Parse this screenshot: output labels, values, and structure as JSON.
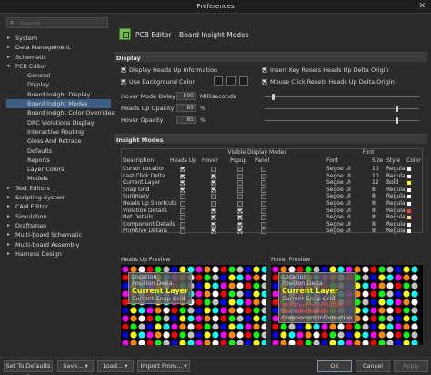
{
  "window": {
    "title": "Preferences",
    "close_glyph": "✕"
  },
  "search": {
    "placeholder": "Search"
  },
  "tree": [
    {
      "label": "System",
      "child": false,
      "arrow": "▸"
    },
    {
      "label": "Data Management",
      "child": false,
      "arrow": "▸"
    },
    {
      "label": "Schematic",
      "child": false,
      "arrow": "▸"
    },
    {
      "label": "PCB Editor",
      "child": false,
      "arrow": "▾"
    },
    {
      "label": "General",
      "child": true
    },
    {
      "label": "Display",
      "child": true
    },
    {
      "label": "Board Insight Display",
      "child": true
    },
    {
      "label": "Board Insight Modes",
      "child": true,
      "selected": true
    },
    {
      "label": "Board Insight Color Overrides",
      "child": true
    },
    {
      "label": "DRC Violations Display",
      "child": true
    },
    {
      "label": "Interactive Routing",
      "child": true
    },
    {
      "label": "Gloss And Retrace",
      "child": true
    },
    {
      "label": "Defaults",
      "child": true
    },
    {
      "label": "Reports",
      "child": true
    },
    {
      "label": "Layer Colors",
      "child": true
    },
    {
      "label": "Models",
      "child": true
    },
    {
      "label": "Text Editors",
      "child": false,
      "arrow": "▸"
    },
    {
      "label": "Scripting System",
      "child": false,
      "arrow": "▸"
    },
    {
      "label": "CAM Editor",
      "child": false,
      "arrow": "▸"
    },
    {
      "label": "Simulation",
      "child": false,
      "arrow": "▸"
    },
    {
      "label": "Draftsman",
      "child": false,
      "arrow": "▸"
    },
    {
      "label": "Multi-board Schematic",
      "child": false,
      "arrow": "▸"
    },
    {
      "label": "Multi-board Assembly",
      "child": false,
      "arrow": "▸"
    },
    {
      "label": "Harness Design",
      "child": false,
      "arrow": "▸"
    }
  ],
  "header": {
    "title": "PCB Editor – Board Insight Modes"
  },
  "display": {
    "section_title": "Display",
    "display_heads_up": "Display Heads Up Information",
    "use_background_color": "Use Background Color",
    "insert_key_resets": "Insert Key Resets Heads Up Delta Origin",
    "mouse_click_resets": "Mouse Click Resets Heads Up Delta Origin",
    "hover_mode_delay_label": "Hover Mode Delay",
    "hover_mode_delay_value": "500",
    "hover_mode_delay_unit": "Milliseconds",
    "heads_up_opacity_label": "Heads Up Opacity",
    "heads_up_opacity_value": "85",
    "hover_opacity_label": "Hover Opacity",
    "hover_opacity_value": "85",
    "percent": "%",
    "heads_up_opacity_level": 0.85,
    "hover_opacity_level": 0.85,
    "hover_delay_level": 0.05
  },
  "modes": {
    "section_title": "Insight Modes",
    "group_visible": "Visible Display Modes",
    "group_font": "Font",
    "columns": [
      "Description",
      "Heads Up",
      "Hover",
      "Popup",
      "Panel",
      "Font",
      "Size",
      "Style",
      "Color"
    ],
    "rows": [
      {
        "desc": "Cursor Location",
        "heads": true,
        "hover": false,
        "popup": false,
        "panel": false,
        "font": "Segoe UI",
        "size": "10",
        "style": "Regular",
        "color": "#ffffff"
      },
      {
        "desc": "Last Click Delta",
        "heads": true,
        "hover": true,
        "popup": false,
        "panel": false,
        "font": "Segoe UI",
        "size": "10",
        "style": "Regular",
        "color": "#ffffff"
      },
      {
        "desc": "Current Layer",
        "heads": true,
        "hover": true,
        "popup": false,
        "panel": false,
        "font": "Segoe UI",
        "size": "12",
        "style": "Bold",
        "color": "#ffff00"
      },
      {
        "desc": "Snap Grid",
        "heads": true,
        "hover": true,
        "popup": false,
        "panel": false,
        "font": "Segoe UI",
        "size": "8",
        "style": "Regular",
        "color": "#ffffff"
      },
      {
        "desc": "Summary",
        "heads": false,
        "hover": false,
        "popup": false,
        "panel": false,
        "font": "Segoe UI",
        "size": "8",
        "style": "Regular",
        "color": "#ffffff"
      },
      {
        "desc": "Heads Up Shortcuts",
        "heads": false,
        "hover": false,
        "popup": false,
        "panel": false,
        "font": "Segoe UI",
        "size": "8",
        "style": "Regular",
        "color": "#ffffff"
      },
      {
        "desc": "Violation Details",
        "heads": false,
        "hover": true,
        "popup": true,
        "panel": false,
        "font": "Segoe UI",
        "size": "8",
        "style": "Regular",
        "color": "#ff3b3b"
      },
      {
        "desc": "Net Details",
        "heads": false,
        "hover": true,
        "popup": true,
        "panel": false,
        "font": "Segoe UI",
        "size": "8",
        "style": "Regular",
        "color": "#ffcc80"
      },
      {
        "desc": "Component Details",
        "heads": false,
        "hover": true,
        "popup": true,
        "panel": false,
        "font": "Segoe UI",
        "size": "8",
        "style": "Regular",
        "color": "#ffffff"
      },
      {
        "desc": "Primitive Details",
        "heads": false,
        "hover": true,
        "popup": true,
        "panel": false,
        "font": "Segoe UI",
        "size": "8",
        "style": "Regular",
        "color": "#ffffff"
      }
    ]
  },
  "previews": {
    "heads_up_label": "Heads Up Preview",
    "hover_label": "Hover Preview",
    "heads_up_lines": [
      "Location",
      "Position Delta",
      "Current Layer",
      "Current Snap Grid"
    ],
    "hover_lines": [
      "Location",
      "Position Delta",
      "Current Layer",
      "Current Snap Grid",
      "Violation Information",
      "Net Information",
      "Component Information"
    ]
  },
  "footer": {
    "set_defaults": "Set To Defaults",
    "save": "Save...",
    "load": "Load...",
    "import": "Import From...",
    "ok": "OK",
    "cancel": "Cancel",
    "apply": "Apply",
    "dropdown_glyph": "▾"
  }
}
